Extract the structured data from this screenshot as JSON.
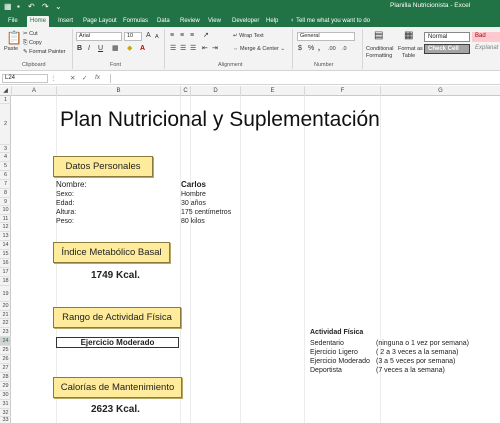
{
  "window": {
    "title": "Planilla Nutricionista  -  Excel"
  },
  "quick_access": {
    "app_icon": "excel-icon",
    "save_icon": "save-icon",
    "undo_icon": "undo-icon",
    "redo_icon": "redo-icon"
  },
  "tabs": [
    "File",
    "Home",
    "Insert",
    "Page Layout",
    "Formulas",
    "Data",
    "Review",
    "View",
    "Developer",
    "Help"
  ],
  "active_tab": "Home",
  "tell_me": "Tell me what you want to do",
  "ribbon": {
    "clipboard": {
      "paste": "Paste",
      "cut": "Cut",
      "copy": "Copy",
      "format_painter": "Format Painter",
      "label": "Clipboard"
    },
    "font": {
      "name": "Arial",
      "size": "10",
      "bold": "B",
      "italic": "I",
      "underline": "U",
      "grow": "A",
      "shrink": "A",
      "fill_icon": "fill-color-icon",
      "color_icon": "font-color-icon",
      "label": "Font"
    },
    "alignment": {
      "wrap_text": "Wrap Text",
      "merge_center": "Merge & Center",
      "label": "Alignment"
    },
    "number": {
      "format": "General",
      "currency": "$",
      "percent": "%",
      "comma": ",",
      "label": "Number"
    },
    "styles": {
      "conditional_1": "Conditional",
      "conditional_2": "Formatting",
      "format_table_1": "Format as",
      "format_table_2": "Table",
      "normal": "Normal",
      "bad": "Bad",
      "check_cell": "Check Cell",
      "explanatory": "Explanat",
      "colors": {
        "normal_bg": "#ffffff",
        "bad_bg": "#ffc7ce",
        "bad_fg": "#9c0006",
        "check_bg": "#a5a5a5",
        "check_fg": "#ffffff"
      }
    }
  },
  "formula_bar": {
    "name_box": "L24",
    "fx": "fx",
    "cancel": "✕",
    "enter": "✓",
    "value": ""
  },
  "columns": [
    "A",
    "B",
    "C",
    "D",
    "E",
    "F",
    "G"
  ],
  "rows": [
    "1",
    "2",
    "3",
    "4",
    "5",
    "6",
    "7",
    "8",
    "9",
    "10",
    "11",
    "12",
    "13",
    "14",
    "15",
    "16",
    "17",
    "18",
    "19",
    "20",
    "21",
    "22",
    "23",
    "24",
    "25",
    "26",
    "27",
    "28",
    "29",
    "30",
    "31",
    "32",
    "33"
  ],
  "selected_row": "24",
  "sheet": {
    "title": "Plan Nutricional y Suplementación",
    "datos_personales": {
      "header": "Datos Personales",
      "name_label": "Nombre:",
      "name_value": "Carlos",
      "sexo_label": "Sexo:",
      "sexo_value": "Hombre",
      "edad_label": "Edad:",
      "edad_value": "30 años",
      "altura_label": "Altura:",
      "altura_value": "175 centímetros",
      "peso_label": "Peso:",
      "peso_value": "80 kilos"
    },
    "imb": {
      "header": "Índice Metabólico Basal",
      "value": "1749 Kcal."
    },
    "actividad": {
      "header": "Rango de Actividad Física",
      "value": "Ejercicio Moderado"
    },
    "actividad_table": {
      "title": "Actividad Física",
      "rows": [
        {
          "name": "Sedentario",
          "desc": "(ninguna o 1 vez por semana)"
        },
        {
          "name": "Ejercicio Ligero",
          "desc": "( 2 a 3 veces a la semana)"
        },
        {
          "name": "Ejercicio Moderado",
          "desc": "(3 a 5 veces por semana)"
        },
        {
          "name": "Deportista",
          "desc": "(7 veces a la semana)"
        }
      ]
    },
    "mantenimiento": {
      "header": "Calorías de Mantenimiento",
      "value": "2623 Kcal."
    }
  },
  "colors": {
    "excel_green": "#217346",
    "header_yellow": "#ffeb9c"
  }
}
